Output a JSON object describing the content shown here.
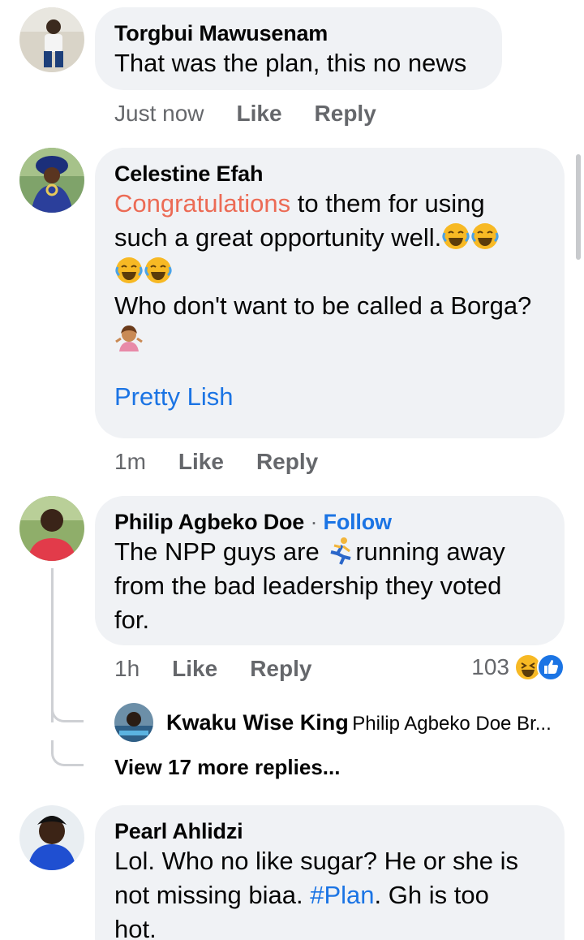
{
  "comments": [
    {
      "author": "Torgbui Mawusenam",
      "text": "That was the plan, this no news",
      "time": "Just now",
      "like": "Like",
      "reply": "Reply"
    },
    {
      "author": "Celestine Efah",
      "text_highlight": "Congratulations",
      "text_line1_rest": " to them for using",
      "text_line2": "such a great opportunity well.",
      "text_line4": "Who don't want to be called a Borga?",
      "tag": "Pretty Lish",
      "time": "1m",
      "like": "Like",
      "reply": "Reply"
    },
    {
      "author": "Philip Agbeko Doe",
      "separator": "·",
      "follow": "Follow",
      "text_line1_a": "The NPP guys are ",
      "text_line1_b": "running away",
      "text_line2": "from the bad leadership they voted",
      "text_line3": "for.",
      "time": "1h",
      "like": "Like",
      "reply": "Reply",
      "reaction_count": "103",
      "reply_preview": {
        "author": "Kwaku Wise King",
        "text": "Philip Agbeko Doe Br..."
      },
      "view_more": "View 17 more replies..."
    },
    {
      "author": "Pearl Ahlidzi",
      "text_line1": "Lol. Who no like sugar? He or she is",
      "text_line2_a": "not missing biaa. ",
      "hashtag": "#Plan",
      "text_line2_b": ". Gh is too",
      "text_line3": "hot."
    }
  ],
  "icons": {
    "laugh": "laughing-tears-emoji",
    "shrug": "woman-shrugging-emoji",
    "runner": "running-person-emoji",
    "haha_reaction": "haha-reaction-icon",
    "like_reaction": "like-reaction-icon"
  },
  "colors": {
    "bubble": "#f0f2f5",
    "meta": "#65676b",
    "link": "#1b74e4",
    "highlight": "#ec6b55"
  }
}
